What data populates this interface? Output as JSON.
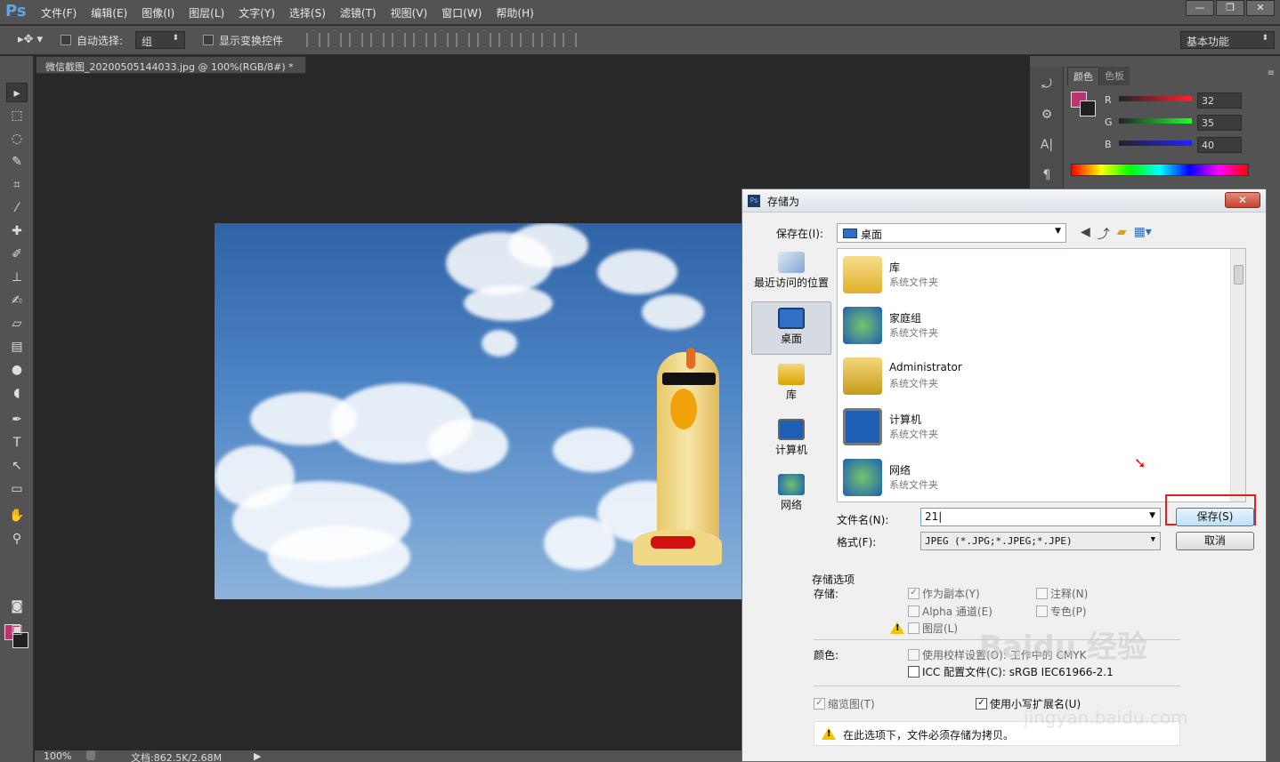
{
  "app": {
    "logo": "Ps",
    "menu": [
      "文件(F)",
      "编辑(E)",
      "图像(I)",
      "图层(L)",
      "文字(Y)",
      "选择(S)",
      "滤镜(T)",
      "视图(V)",
      "窗口(W)",
      "帮助(H)"
    ],
    "window_buttons": [
      "—",
      "❐",
      "✕"
    ]
  },
  "options": {
    "auto_select_label": "自动选择:",
    "auto_select_value": "组",
    "transform_label": "显示变换控件",
    "workspace": "基本功能"
  },
  "document": {
    "tab_title": "微信截图_20200505144033.jpg @ 100%(RGB/8#) *",
    "tab_close": "×",
    "zoom": "100%",
    "doc_info": "文档:862.5K/2.68M"
  },
  "color_panel": {
    "tabs": [
      "颜色",
      "色板"
    ],
    "r_label": "R",
    "r_value": "32",
    "g_label": "G",
    "g_value": "35",
    "b_label": "B",
    "b_value": "40",
    "fg": "#b8356d",
    "bg": "#202020"
  },
  "dialog": {
    "title": "存储为",
    "save_in_label": "保存在(I):",
    "save_in_value": "桌面",
    "places": [
      "最近访问的位置",
      "桌面",
      "库",
      "计算机",
      "网络"
    ],
    "files": [
      {
        "name": "库",
        "desc": "系统文件夹"
      },
      {
        "name": "家庭组",
        "desc": "系统文件夹"
      },
      {
        "name": "Administrator",
        "desc": "系统文件夹"
      },
      {
        "name": "计算机",
        "desc": "系统文件夹"
      },
      {
        "name": "网络",
        "desc": "系统文件夹"
      }
    ],
    "filename_label": "文件名(N):",
    "filename_value": "21|",
    "format_label": "格式(F):",
    "format_value": "JPEG (*.JPG;*.JPEG;*.JPE)",
    "save_button": "保存(S)",
    "cancel_button": "取消",
    "options_header": "存储选项",
    "save_label": "存储:",
    "as_copy": "作为副本(Y)",
    "notes": "注释(N)",
    "alpha": "Alpha 通道(E)",
    "spot": "专色(P)",
    "layers": "图层(L)",
    "color_label": "颜色:",
    "proof": "使用校样设置(O):",
    "proof_value": "工作中的 CMYK",
    "icc": "ICC 配置文件(C):",
    "icc_value": "sRGB IEC61966-2.1",
    "thumbnail": "缩览图(T)",
    "lowercase": "使用小写扩展名(U)",
    "warning": "在此选项下，文件必须存储为拷贝。"
  },
  "watermark": {
    "line1": "Baidu 经验",
    "line2": "jingyan.baidu.com"
  }
}
